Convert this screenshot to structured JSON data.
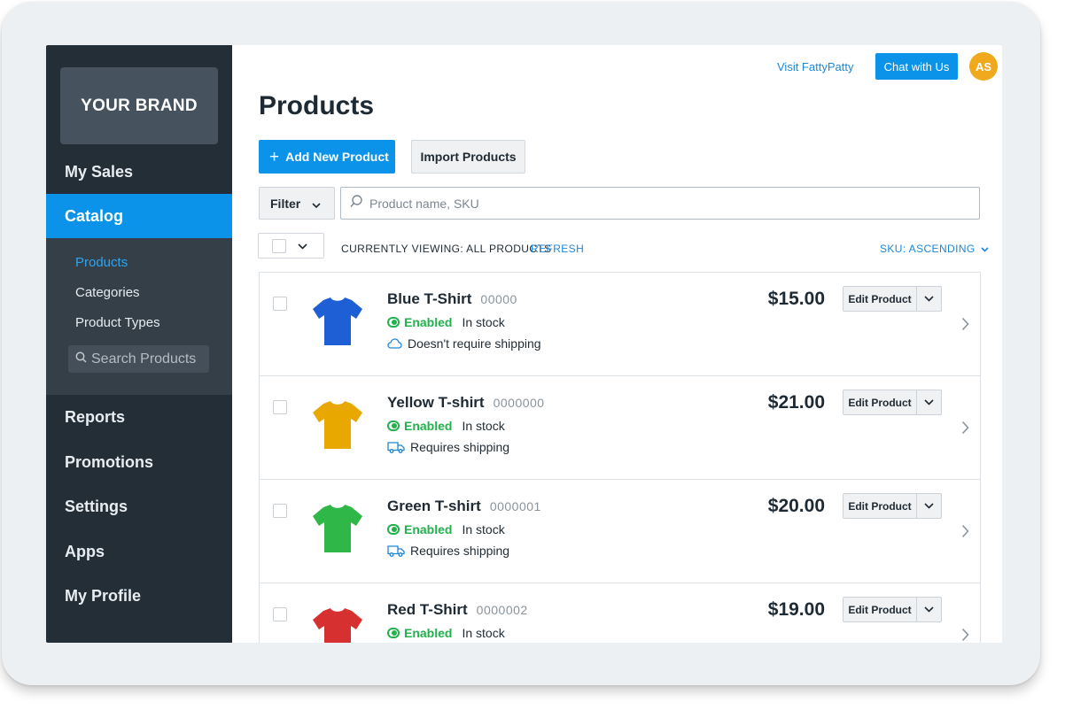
{
  "colors": {
    "sidebar_bg": "#242e37",
    "accent": "#0a93e8",
    "enabled": "#22b14c",
    "link": "#1e87d4",
    "avatar": "#f0a81c"
  },
  "sidebar": {
    "brand": "YOUR BRAND",
    "items": [
      {
        "label": "My Sales",
        "active": false
      },
      {
        "label": "Catalog",
        "active": true
      },
      {
        "label": "Reports",
        "active": false
      },
      {
        "label": "Promotions",
        "active": false
      },
      {
        "label": "Settings",
        "active": false
      },
      {
        "label": "Apps",
        "active": false
      },
      {
        "label": "My Profile",
        "active": false
      }
    ],
    "subitems": [
      {
        "label": "Products",
        "active": true
      },
      {
        "label": "Categories",
        "active": false
      },
      {
        "label": "Product Types",
        "active": false
      }
    ],
    "search_placeholder": "Search Products"
  },
  "header": {
    "visit_link": "Visit FattyPatty",
    "chat_button": "Chat with Us",
    "avatar_initials": "AS"
  },
  "main": {
    "title": "Products",
    "add_button": "Add New Product",
    "import_button": "Import Products",
    "filter_label": "Filter",
    "search_placeholder": "Product name, SKU",
    "viewing_label": "CURRENTLY VIEWING: ALL PRODUCTS",
    "refresh_label": "REFRESH",
    "sort_label": "SKU: ASCENDING",
    "edit_label": "Edit Product"
  },
  "products": [
    {
      "name": "Blue T-Shirt",
      "sku": "00000",
      "price": "$15.00",
      "status": "Enabled",
      "stock": "In stock",
      "shipping": "Doesn't require shipping",
      "ship_icon": "cloud-icon",
      "color": "#1f5fd6"
    },
    {
      "name": "Yellow T-shirt",
      "sku": "0000000",
      "price": "$21.00",
      "status": "Enabled",
      "stock": "In stock",
      "shipping": "Requires shipping",
      "ship_icon": "truck-icon",
      "color": "#e8a800"
    },
    {
      "name": "Green T-shirt",
      "sku": "0000001",
      "price": "$20.00",
      "status": "Enabled",
      "stock": "In stock",
      "shipping": "Requires shipping",
      "ship_icon": "truck-icon",
      "color": "#2fb848"
    },
    {
      "name": "Red T-Shirt",
      "sku": "0000002",
      "price": "$19.00",
      "status": "Enabled",
      "stock": "In stock",
      "shipping": "",
      "ship_icon": "",
      "color": "#d63030"
    }
  ]
}
